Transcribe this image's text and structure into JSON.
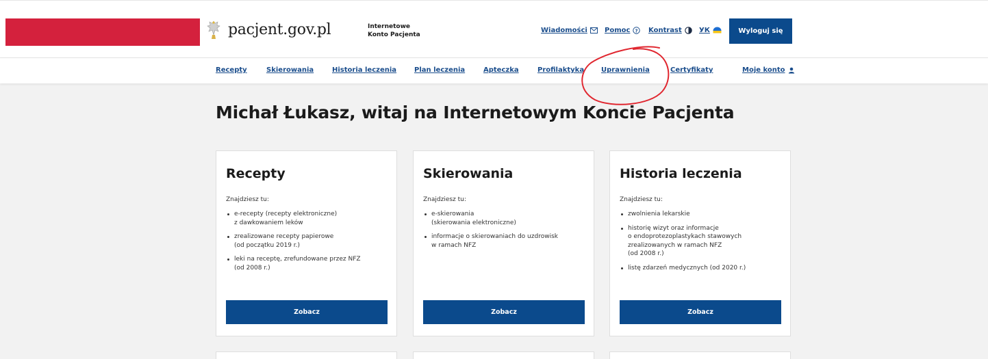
{
  "brand": {
    "name": "pacjent.gov.pl",
    "subtitle_line1": "Internetowe",
    "subtitle_line2": "Konto Pacjenta"
  },
  "toplinks": {
    "messages": "Wiadomości",
    "help": "Pomoc",
    "contrast": "Kontrast",
    "language": "УК",
    "logout": "Wyloguj się"
  },
  "nav": {
    "items": [
      "Recepty",
      "Skierowania",
      "Historia leczenia",
      "Plan leczenia",
      "Apteczka",
      "Profilaktyka",
      "Uprawnienia",
      "Certyfikaty"
    ],
    "account": "Moje konto"
  },
  "welcome": "Michał Łukasz, witaj na Internetowym Koncie Pacjenta",
  "cards": [
    {
      "title": "Recepty",
      "intro": "Znajdziesz tu:",
      "items": [
        [
          "e-recepty (recepty elektroniczne)",
          "z dawkowaniem leków"
        ],
        [
          "zrealizowane recepty papierowe",
          "(od początku 2019 r.)"
        ],
        [
          "leki na receptę, zrefundowane przez NFZ",
          "(od 2008 r.)"
        ]
      ],
      "button": "Zobacz"
    },
    {
      "title": "Skierowania",
      "intro": "Znajdziesz tu:",
      "items": [
        [
          "e-skierowania",
          "(skierowania elektroniczne)"
        ],
        [
          "informacje o skierowaniach do uzdrowisk",
          "w ramach NFZ"
        ]
      ],
      "button": "Zobacz"
    },
    {
      "title": "Historia leczenia",
      "intro": "Znajdziesz tu:",
      "items": [
        [
          "zwolnienia lekarskie"
        ],
        [
          "historię wizyt oraz informacje",
          "o endoprotezoplastykach stawowych",
          "zrealizowanych w ramach NFZ",
          "(od 2008 r.)"
        ],
        [
          "listę zdarzeń medycznych (od 2020 r.)"
        ]
      ],
      "button": "Zobacz"
    }
  ],
  "colors": {
    "accent": "#0b4a8c",
    "link": "#1a4d8c",
    "brand_red": "#d4213d",
    "annotation": "#e0262f"
  },
  "icons": [
    "eagle-emblem-icon",
    "envelope-icon",
    "help-circle-icon",
    "contrast-icon",
    "ukraine-flag-icon",
    "user-icon"
  ]
}
